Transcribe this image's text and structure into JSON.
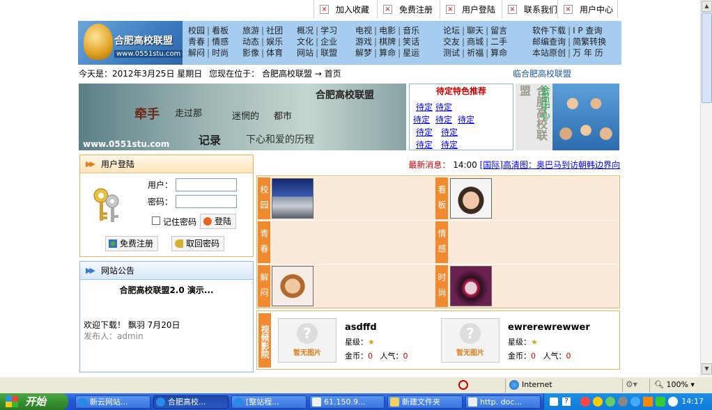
{
  "toplinks": [
    {
      "label": "加入收藏"
    },
    {
      "label": "免费注册"
    },
    {
      "label": "用户登陆"
    },
    {
      "label": "联系我们"
    },
    {
      "label": "用户中心"
    }
  ],
  "logo": {
    "title": "合肥高校联盟",
    "url": "www.0551stu.com"
  },
  "nav": {
    "g1": [
      "校园",
      "看板",
      "青春",
      "情感",
      "解闷",
      "时尚"
    ],
    "g2": [
      "旅游",
      "社团",
      "动态",
      "娱乐",
      "影像",
      "体育"
    ],
    "g3": [
      "概况",
      "学习",
      "文化",
      "企业",
      "网站",
      "联盟"
    ],
    "g4": [
      "电视",
      "电影",
      "音乐",
      "游戏",
      "棋牌",
      "笑话",
      "解梦",
      "算命",
      "星运"
    ],
    "g5": [
      "论坛",
      "聊天",
      "留言",
      "交友",
      "商城",
      "二手",
      "测试",
      "祈福",
      "算命"
    ],
    "g6": [
      "软件下载",
      "I P 查询",
      "邮编查询",
      "简繁转换",
      "本站原创",
      "万 年 历"
    ]
  },
  "path": {
    "today": "今天是：2012年3月25日 星期日",
    "location": "您现在位于：",
    "site": "合肥高校联盟",
    "arrow": "→",
    "home": "首页",
    "marquee": "临合肥高校联盟"
  },
  "banner": {
    "l1": "牵手",
    "l2": "走过那",
    "l3": "迷惘的",
    "l4": "都市",
    "l5": "记录",
    "l6": "下心和爱的历程",
    "url": "www.0551stu.com",
    "title": "合肥高校联盟"
  },
  "recommend": {
    "title": "待定特色推荐",
    "item": "待定"
  },
  "side": {
    "v1": "合肥高校联盟",
    "v2": "会员中心"
  },
  "login": {
    "title": "用户登陆",
    "user": "用户：",
    "pass": "密码：",
    "remember": "记住密码",
    "submit": "登陆",
    "register": "免费注册",
    "retrieve": "取回密码"
  },
  "notice": {
    "title": "网站公告",
    "headline": "合肥高校联盟2.0 演示...",
    "body": "欢迎下载！ 飘羽 7月20日",
    "poster": "发布人：admin"
  },
  "news": {
    "label": "最新消息：",
    "time": "14:00",
    "text": "[国际]高清图：奥巴马到访朝韩边界向"
  },
  "grid": [
    {
      "label": "校园",
      "label2": "看板"
    },
    {
      "label": "青春",
      "label2": "情感"
    },
    {
      "label": "解闷",
      "label2": "时尚"
    }
  ],
  "video": {
    "label": "视频影院",
    "nopic": "暂无图片",
    "items": [
      {
        "name": "asdffd",
        "stars": "星级：",
        "gold": "金币：",
        "gold_v": "0",
        "pop": "人气：",
        "pop_v": "0"
      },
      {
        "name": "ewrerewrewwer",
        "stars": "星级：",
        "gold": "金币：",
        "gold_v": "0",
        "pop": "人气：",
        "pop_v": "0"
      }
    ]
  },
  "status": {
    "zone": "Internet",
    "zoom": "100%"
  },
  "taskbar": {
    "start": "开始",
    "tasks": [
      "新云网站...",
      "合肥高校...",
      "[整站程...",
      "61.150.9...",
      "新建文件夹",
      "http. doc..."
    ],
    "time": "14:17"
  },
  "colors": {
    "nav_bg": "#a6cdf0",
    "orange": "#f08a30",
    "taskbar": "#2459d8"
  }
}
